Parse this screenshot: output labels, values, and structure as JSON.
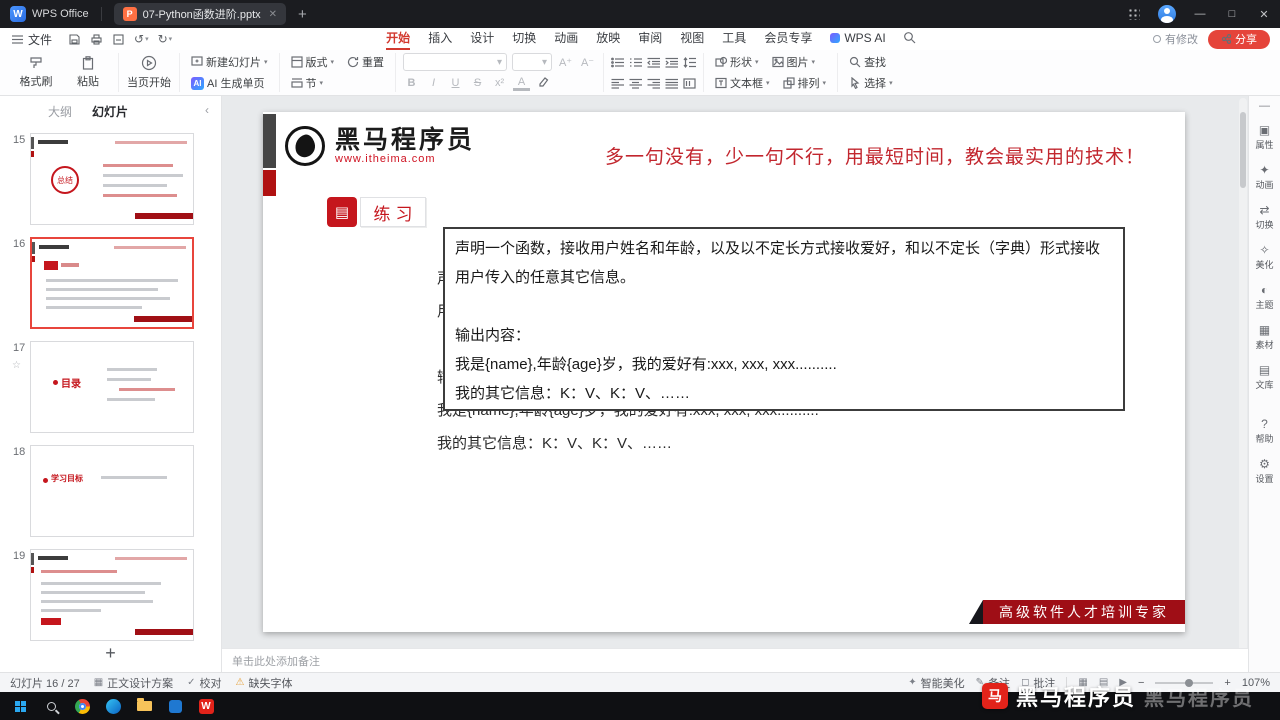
{
  "titlebar": {
    "app_name": "WPS Office",
    "doc_tab": "07-Python函数进阶.pptx",
    "ppt_badge": "P",
    "new_tab": "+",
    "minimize": "—",
    "maximize": "□",
    "close": "✕"
  },
  "menubar": {
    "file": "文件",
    "tabs": [
      "开始",
      "插入",
      "设计",
      "切换",
      "动画",
      "放映",
      "审阅",
      "视图",
      "工具",
      "会员专享",
      "WPS AI"
    ],
    "modified": "有修改",
    "share": "分享"
  },
  "ribbon": {
    "format_painter": "格式刷",
    "paste": "粘贴",
    "start_here": "当页开始",
    "new_slide": "新建幻灯片",
    "ai_generate": "AI 生成单页",
    "layout": "版式",
    "reset": "重置",
    "section": "节",
    "bold": "B",
    "italic": "I",
    "underline": "U",
    "strike": "S",
    "superscript": "x²",
    "font_color": "A",
    "font_bigger": "A⁺",
    "font_smaller": "A⁻",
    "shape": "形状",
    "picture": "图片",
    "textbox": "文本框",
    "arrange": "排列",
    "find": "查找",
    "select": "选择"
  },
  "slides_panel": {
    "outline_tab": "大纲",
    "slides_tab": "幻灯片",
    "collapse": "‹",
    "add": "+",
    "slides": [
      {
        "num": "15",
        "summary": "总结"
      },
      {
        "num": "16"
      },
      {
        "num": "17",
        "title": "目录",
        "star": "☆"
      },
      {
        "num": "18",
        "title": "学习目标"
      },
      {
        "num": "19"
      }
    ]
  },
  "slide": {
    "brand_name": "黑马程序员",
    "brand_url": "www.itheima.com",
    "slogan": "多一句没有，少一句不行，用最短时间，教会最实用的技术！",
    "badge_icon": "▤",
    "badge": "练习",
    "body_lines": {
      "l1": "声明一个函数，接收用户姓名和年龄，以及以不定长方式接收爱好，和以不定长（字典）形式接收",
      "l2": "用户传入的任意其它信息。",
      "l3": "输出内容：",
      "l4": "我是{name},年龄{age}岁，我的爱好有:xxx, xxx, xxx..........",
      "l5": "我的其它信息：K：V、K：V、……"
    },
    "textbox": {
      "p1": "声明一个函数，接收用户姓名和年龄，以及以不定长方式接收爱好，和以不定长（字典）形式接收用户传入的任意其它信息。",
      "p2": "输出内容：",
      "p3": "我是{name},年龄{age}岁，我的爱好有:xxx, xxx, xxx..........",
      "p4": "我的其它信息：K：V、K：V、……"
    },
    "footer_banner": "高级软件人才培训专家"
  },
  "notes": {
    "placeholder": "单击此处添加备注"
  },
  "statusbar": {
    "slide_counter": "幻灯片 16 / 27",
    "design_scheme": "正文设计方案",
    "proofread": "校对",
    "missing_font": "缺失字体",
    "beautify": "智能美化",
    "note": "备注",
    "comment": "批注",
    "zoom_out": "−",
    "zoom_in": "+",
    "zoom": "107%"
  },
  "right_rail": {
    "collapse": "—",
    "items": [
      {
        "icon": "▣",
        "label": "属性"
      },
      {
        "icon": "✦",
        "label": "动画"
      },
      {
        "icon": "⇄",
        "label": "切换"
      },
      {
        "icon": "✧",
        "label": "美化"
      },
      {
        "icon": "◐",
        "label": "主题"
      },
      {
        "icon": "▦",
        "label": "素材"
      },
      {
        "icon": "▤",
        "label": "文库"
      },
      {
        "icon": "?",
        "label": "帮助"
      },
      {
        "icon": "⚙",
        "label": "设置"
      }
    ]
  },
  "watermark": {
    "logo": "马",
    "text": "黑马程序员"
  },
  "icons": {
    "view_normal": "▦",
    "view_sorter": "▤",
    "view_play": "▶",
    "scheme": "▦",
    "proof_check": "✓",
    "warn": "⚠",
    "beautify": "✦",
    "note_pen": "✎",
    "comment_box": "◻"
  },
  "taskbar": {
    "icons": [
      "start",
      "search",
      "chrome",
      "edge",
      "folder",
      "docs",
      "wps"
    ]
  }
}
